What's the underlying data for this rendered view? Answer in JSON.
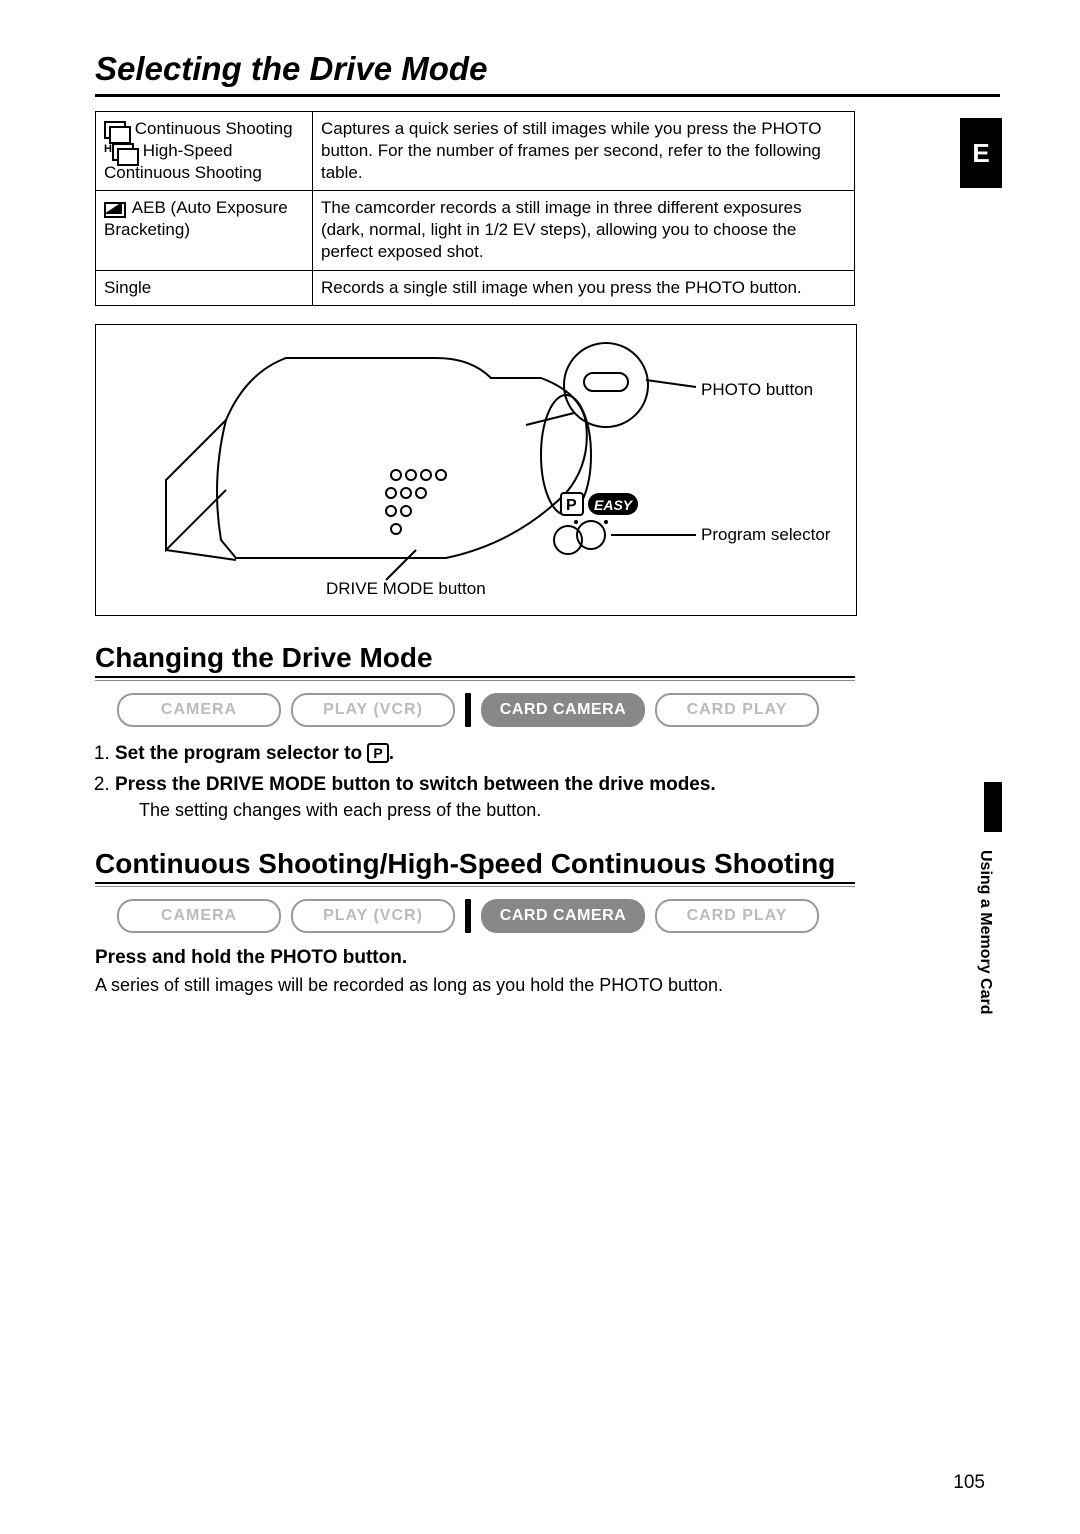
{
  "header": {
    "title": "Selecting the Drive Mode",
    "lang_tab": "E",
    "section_tab": "Using a Memory Card",
    "page_number": "105"
  },
  "table": {
    "rows": [
      {
        "label1": "Continuous Shooting",
        "label2": "High-Speed Continuous Shooting",
        "desc": "Captures a quick series of still images while you press the PHOTO button. For the number of frames per second, refer to the following table."
      },
      {
        "label1": "AEB (Auto Exposure Bracketing)",
        "desc": "The camcorder records a still image in three different exposures (dark, normal, light in 1/2 EV steps), allowing you to choose the perfect exposed shot."
      },
      {
        "label1": "Single",
        "desc": "Records a single still image when you press the PHOTO button."
      }
    ]
  },
  "diagram": {
    "label_photo": "PHOTO button",
    "label_selector": "Program selector",
    "label_drive": "DRIVE MODE button",
    "p": "P",
    "easy": "EASY"
  },
  "section1": {
    "heading": "Changing the Drive Mode",
    "modes": [
      "CAMERA",
      "PLAY (VCR)",
      "CARD CAMERA",
      "CARD PLAY"
    ],
    "active_index": 2,
    "step1_a": "Set the program selector to ",
    "step1_b": ".",
    "step2": "Press the DRIVE MODE button to switch between the drive modes.",
    "step2_sub": "The setting changes with each press of the button."
  },
  "section2": {
    "heading": "Continuous Shooting/High-Speed Continuous Shooting",
    "modes": [
      "CAMERA",
      "PLAY (VCR)",
      "CARD CAMERA",
      "CARD PLAY"
    ],
    "active_index": 2,
    "line_b": "Press and hold the PHOTO button.",
    "line": "A series of still images will be recorded as long as you hold the PHOTO button."
  }
}
